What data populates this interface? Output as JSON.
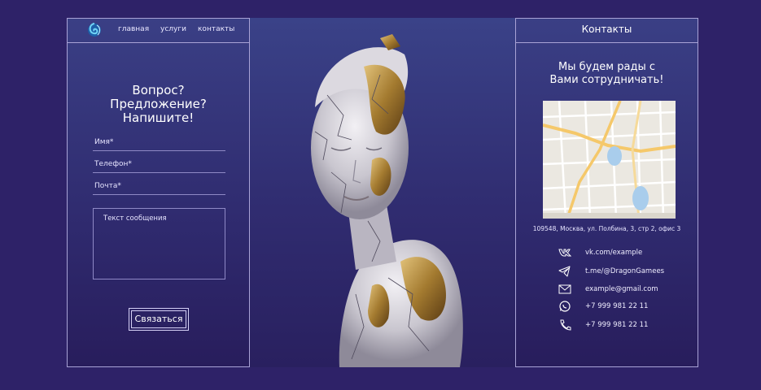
{
  "nav": {
    "logo_icon": "spiral-logo-icon",
    "links": [
      "главная",
      "услуги",
      "контакты"
    ]
  },
  "form": {
    "title": "Вопрос?\nПредложение?\nНапишите!",
    "fields": [
      {
        "placeholder": "Имя*"
      },
      {
        "placeholder": "Телефон*"
      },
      {
        "placeholder": "Почта*"
      }
    ],
    "message_placeholder": "Текст сообщения",
    "submit_label": "Связаться"
  },
  "hero": {
    "image": "cracked-marble-sculpture-woman-gold"
  },
  "contacts": {
    "title": "Контакты",
    "subtitle": "Мы будем рады с\nВами сотрудничать!",
    "address": "109548, Москва, ул. Полбина, 3, стр 2, офис 3",
    "items": [
      {
        "icon": "vk-icon",
        "text": "vk.com/example"
      },
      {
        "icon": "telegram-icon",
        "text": "t.me/@DragonGamees"
      },
      {
        "icon": "mail-icon",
        "text": "example@gmail.com"
      },
      {
        "icon": "whatsapp-icon",
        "text": "+7 999 981 22 11"
      },
      {
        "icon": "phone-icon",
        "text": "+7 999 981 22 11"
      }
    ]
  },
  "colors": {
    "background": "#2e2268",
    "panel_border": "#a9a3d6",
    "accent": "#3fa9dc"
  }
}
